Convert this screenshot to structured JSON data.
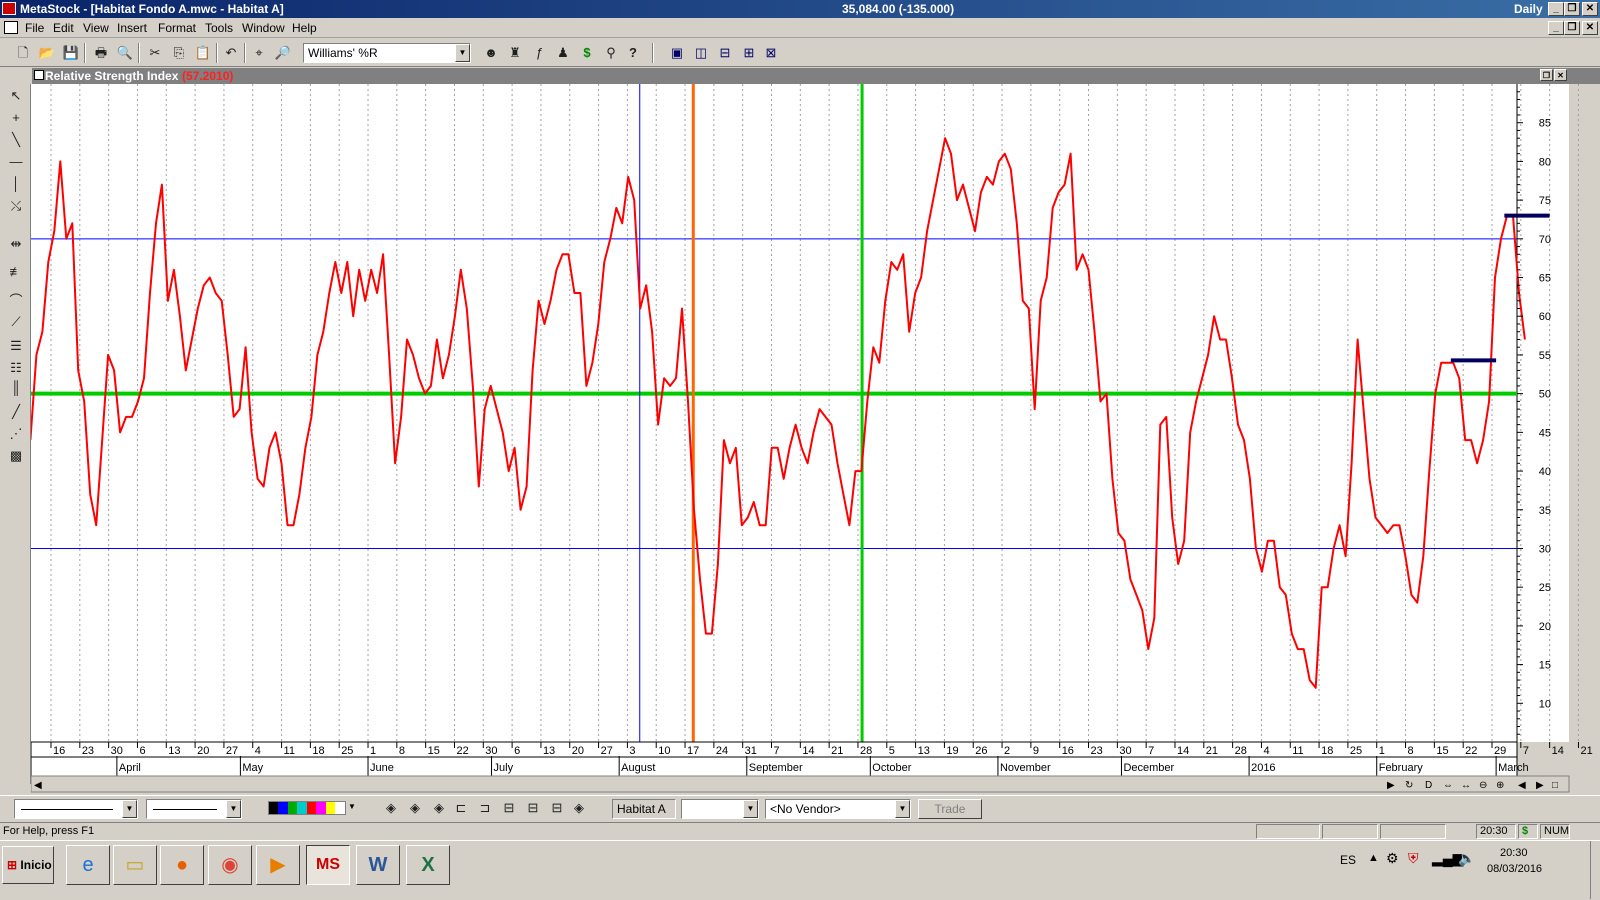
{
  "window": {
    "app_title": "MetaStock - [Habitat Fondo A.mwc - Habitat A]",
    "price": "35,084.00 (-135.000)",
    "periodicity": "Daily"
  },
  "menu": [
    "File",
    "Edit",
    "View",
    "Insert",
    "Format",
    "Tools",
    "Window",
    "Help"
  ],
  "toolbar": {
    "indicator_select": "Williams' %R"
  },
  "chart": {
    "title": "Relative Strength Index",
    "value": "(57.2010)"
  },
  "chart_data": {
    "type": "line",
    "title": "Relative Strength Index",
    "ylim": [
      5,
      90
    ],
    "yticks": [
      10,
      15,
      20,
      25,
      30,
      35,
      40,
      45,
      50,
      55,
      60,
      65,
      70,
      75,
      80,
      85
    ],
    "x_day_labels": [
      "16",
      "23",
      "30",
      "6",
      "13",
      "20",
      "27",
      "4",
      "11",
      "18",
      "25",
      "1",
      "8",
      "15",
      "22",
      "30",
      "6",
      "13",
      "20",
      "27",
      "3",
      "10",
      "17",
      "24",
      "31",
      "7",
      "14",
      "21",
      "28",
      "5",
      "13",
      "19",
      "26",
      "2",
      "9",
      "16",
      "23",
      "30",
      "7",
      "14",
      "21",
      "28",
      "4",
      "11",
      "18",
      "25",
      "1",
      "8",
      "15",
      "22",
      "29",
      "7",
      "14",
      "21"
    ],
    "x_month_labels": [
      "April",
      "May",
      "June",
      "July",
      "August",
      "September",
      "October",
      "November",
      "December",
      "2016",
      "February",
      "March"
    ],
    "horizontal_lines": [
      {
        "value": 70,
        "color": "#0000ff"
      },
      {
        "value": 30,
        "color": "#0000ff"
      },
      {
        "value": 50,
        "color": "#00cc00"
      }
    ],
    "vertical_markers": [
      {
        "date": "2015-08-06",
        "color": "#0000ff"
      },
      {
        "date": "2015-08-19",
        "color": "#ff6600"
      },
      {
        "date": "2015-09-29",
        "color": "#00cc00"
      }
    ],
    "resistance_lines": [
      {
        "from": "2016-02-19",
        "to": "2016-03-01",
        "value": 54.3,
        "color": "#000060"
      },
      {
        "from": "2016-03-03",
        "to": "2016-03-14",
        "value": 73,
        "color": "#000060"
      }
    ],
    "series": [
      {
        "color": "#ff0000",
        "values": [
          44,
          55,
          58,
          67,
          71,
          80,
          70,
          72,
          53,
          49,
          37,
          33,
          44,
          55,
          53,
          45,
          47,
          47,
          49,
          52,
          63,
          72,
          77,
          62,
          66,
          60,
          53,
          57,
          61,
          64,
          65,
          63,
          62,
          55,
          47,
          48,
          56,
          45,
          39,
          38,
          43,
          45,
          41,
          33,
          33,
          37,
          43,
          47,
          55,
          58,
          63,
          67,
          63,
          67,
          60,
          66,
          62,
          66,
          63,
          68,
          55,
          41,
          47,
          57,
          55,
          52,
          50,
          51,
          57,
          52,
          55,
          60,
          66,
          61,
          51,
          38,
          48,
          51,
          48,
          45,
          40,
          43,
          35,
          38,
          53,
          62,
          59,
          62,
          66,
          68,
          68,
          63,
          63,
          51,
          54,
          59,
          67,
          70,
          74,
          72,
          78,
          75,
          61,
          64,
          58,
          46,
          52,
          51,
          52,
          61,
          49,
          35,
          26,
          19,
          19,
          28,
          44,
          41,
          43,
          33,
          34,
          36,
          33,
          33,
          43,
          43,
          39,
          43,
          46,
          43,
          41,
          45,
          48,
          47,
          46,
          41,
          37,
          33,
          40,
          40,
          49,
          56,
          54,
          62,
          67,
          66,
          68,
          58,
          63,
          65,
          71,
          75,
          79,
          83,
          81,
          75,
          77,
          74,
          71,
          76,
          78,
          77,
          80,
          81,
          79,
          72,
          62,
          61,
          48,
          62,
          65,
          74,
          76,
          77,
          81,
          66,
          68,
          66,
          58,
          49,
          50,
          39,
          32,
          31,
          26,
          24,
          22,
          17,
          21,
          46,
          47,
          34,
          28,
          31,
          45,
          49,
          52,
          55,
          60,
          57,
          57,
          52,
          46,
          44,
          39,
          30,
          27,
          31,
          31,
          25,
          24,
          19,
          17,
          17,
          13,
          12,
          25,
          25,
          30,
          33,
          29,
          41,
          57,
          48,
          39,
          34,
          33,
          32,
          33,
          33,
          29,
          24,
          23,
          29,
          40,
          50,
          54,
          54,
          54,
          52,
          44,
          44,
          41,
          44,
          49,
          65,
          70,
          73,
          73,
          63,
          57
        ]
      }
    ]
  },
  "format_bar": {
    "security": "Habitat A",
    "vendor": "<No Vendor>",
    "trade_label": "Trade"
  },
  "status": {
    "help": "For Help, press F1",
    "time": "20:30",
    "currency": "$",
    "num": "NUM"
  },
  "taskbar": {
    "start_label": "Inicio",
    "lang": "ES",
    "clock_time": "20:30",
    "clock_date": "08/03/2016"
  }
}
